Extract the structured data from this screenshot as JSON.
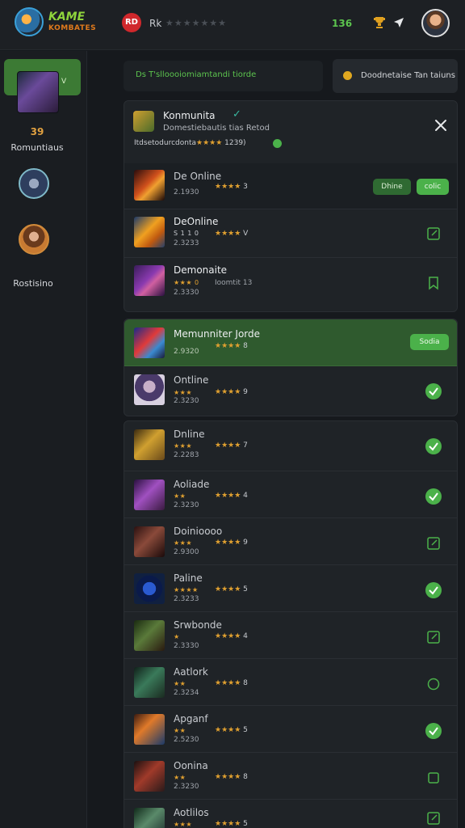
{
  "header": {
    "logo_line1": "KAME",
    "logo_line2": "KOMBATES",
    "rec_badge": "RD",
    "title": "Rk",
    "stars": "★★★★★★★",
    "count": "136",
    "logo_icon": "game-logo-icon",
    "trophy_icon": "trophy-icon",
    "nav_icon": "navigation-arrow-icon",
    "avatar_icon": "user-avatar"
  },
  "sidebar": {
    "items": [
      {
        "badge": "V",
        "count": "39",
        "label": "Romuntiaus",
        "active": true
      },
      {
        "label": ""
      },
      {
        "label": "Rostisino"
      }
    ]
  },
  "strip": {
    "left_text": "Ds T'slloooiomiamtandi tiorde",
    "right_text": "Doodnetaise Tan taiuns"
  },
  "panel1": {
    "title": "Konmunita",
    "check": "✓",
    "subtitle": "Domestiebautis tias Retod",
    "rating_prefix": "Itdsetodurcdonta",
    "rating_stars": "★★★★",
    "rating_count": "1239)",
    "rows": [
      {
        "name": "De Online",
        "sub": "2.1930",
        "stars": "★★★★",
        "score": "3",
        "actions": [
          "Dhine",
          "colic"
        ]
      },
      {
        "name": "DeOnline",
        "mini": "S 1 1 0",
        "sub": "2.3233",
        "stars": "★★★★",
        "score": "V",
        "status": "edit"
      },
      {
        "name": "Demonaite",
        "mini": "★★★ 0",
        "sub": "2.3330",
        "right_label": "Ioomtit 13",
        "status": "bookmark"
      }
    ]
  },
  "highlight": {
    "name": "Memunniter Jorde",
    "sub": "2.9320",
    "stars": "★★★★",
    "score": "8",
    "button": "Sodia"
  },
  "online": {
    "name": "Ontline",
    "mini": "★★★",
    "sub": "2.3230",
    "stars": "★★★★",
    "score": "9",
    "status": "check"
  },
  "list": [
    {
      "name": "Dnline",
      "mini": "★★★",
      "sub": "2.2283",
      "stars": "★★★★",
      "score": "7",
      "status": "check"
    },
    {
      "name": "Aoliade",
      "mini": "★★",
      "sub": "2.3230",
      "stars": "★★★★",
      "score": "4",
      "status": "check"
    },
    {
      "name": "Doinioooo",
      "mini": "★★★",
      "sub": "2.9300",
      "stars": "★★★★",
      "score": "9",
      "status": "edit"
    },
    {
      "name": "Paline",
      "mini": "★★★★",
      "sub": "2.3233",
      "stars": "★★★★",
      "score": "5",
      "status": "check"
    },
    {
      "name": "Srwbonde",
      "mini": "★",
      "sub": "2.3330",
      "stars": "★★★★",
      "score": "4",
      "status": "edit"
    },
    {
      "name": "Aatlork",
      "mini": "★★",
      "sub": "2.3234",
      "stars": "★★★★",
      "score": "8",
      "status": "circle"
    },
    {
      "name": "Apganf",
      "mini": "★★",
      "sub": "2.5230",
      "stars": "★★★★",
      "score": "5",
      "status": "check"
    },
    {
      "name": "Oonina",
      "mini": "★★",
      "sub": "2.3230",
      "stars": "★★★★",
      "score": "8",
      "status": "square"
    },
    {
      "name": "Aotlilos",
      "mini": "★★★",
      "sub": "",
      "stars": "★★★★",
      "score": "5",
      "status": "edit"
    }
  ],
  "colors": {
    "background": "#16191d",
    "panel": "#1f2327",
    "accent_green": "#4bb14a",
    "accent_dark_green": "#2f6a32",
    "star_gold": "#e0a030"
  }
}
